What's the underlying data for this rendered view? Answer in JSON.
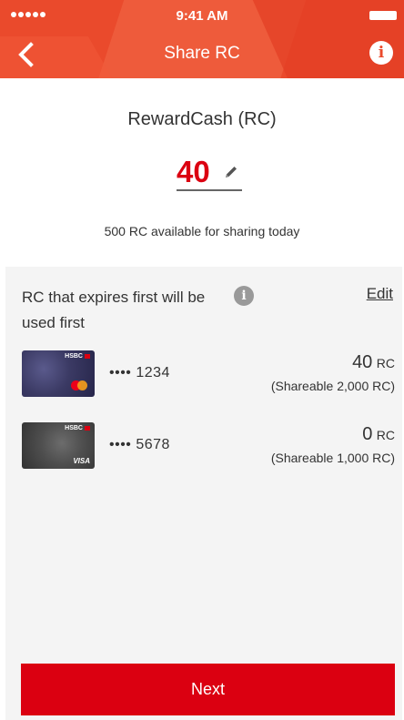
{
  "status_bar": {
    "time": "9:41 AM"
  },
  "nav": {
    "title": "Share RC",
    "back_icon": "chevron-left-icon",
    "info_icon": "info-icon",
    "info_glyph": "i"
  },
  "amount": {
    "title": "RewardCash (RC)",
    "value": "40",
    "available_text": "500 RC available for sharing today"
  },
  "rule": {
    "text": "RC that expires first will be used first",
    "info_glyph": "i",
    "edit_label": "Edit"
  },
  "cards": [
    {
      "brand": "HSBC",
      "network": "mastercard",
      "number": "•••• 1234",
      "amount": "40",
      "unit": "RC",
      "shareable": "(Shareable 2,000 RC)",
      "color": "#3b3a64"
    },
    {
      "brand": "HSBC",
      "network": "visa",
      "network_label": "VISA",
      "number": "•••• 5678",
      "amount": "0",
      "unit": "RC",
      "shareable": "(Shareable 1,000 RC)",
      "color": "#4e4e4e"
    }
  ],
  "footer": {
    "next_label": "Next"
  },
  "colors": {
    "header": "#ea4a2c",
    "accent_red": "#db0011",
    "panel_bg": "#f4f4f4"
  }
}
